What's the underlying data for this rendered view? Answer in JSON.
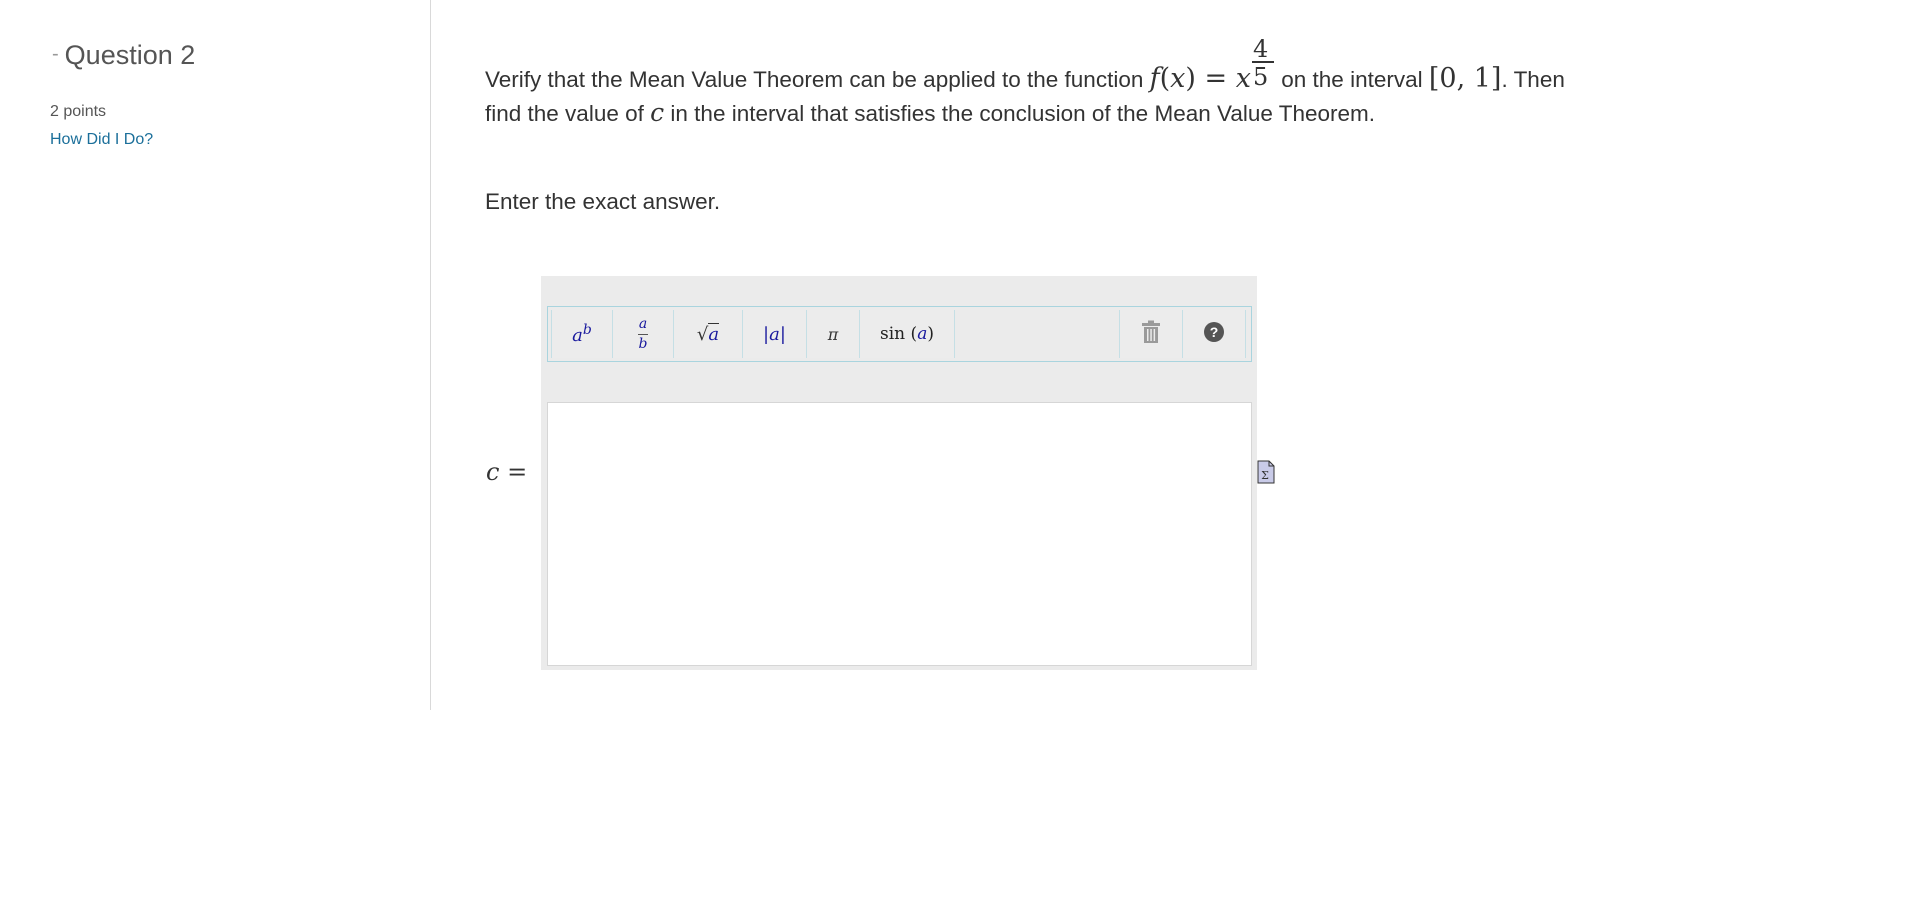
{
  "sidebar": {
    "question_title": "Question 2",
    "collapse_symbol": "-",
    "points": "2 points",
    "feedback_link": "How Did I Do?"
  },
  "question": {
    "text_part1": "Verify that the Mean Value Theorem can be applied to the function",
    "func_f": "f",
    "func_x_open": "(",
    "func_x": "x",
    "func_x_close": ")",
    "equals": "=",
    "base_x": "x",
    "exponent_numerator": "4",
    "exponent_denominator": "5",
    "text_part2": "on the interval",
    "interval": "[0, 1]",
    "text_part3": ". Then",
    "text_line2_a": "find the value of",
    "var_c": "c",
    "text_line2_b": "in the interval that satisfies the conclusion of the Mean Value Theorem.",
    "instruction": "Enter the exact answer."
  },
  "answer": {
    "label_var": "c",
    "label_eq": "=",
    "value": ""
  },
  "toolbar": {
    "power_base": "a",
    "power_exp": "b",
    "frac_num": "a",
    "frac_den": "b",
    "sqrt_arg": "a",
    "abs_arg": "a",
    "pi": "π",
    "sin_fn": "sin",
    "sin_arg": "a",
    "trash_icon": "trash-icon",
    "help_icon": "help-icon",
    "help_symbol": "?"
  },
  "colors": {
    "link": "#1b6f9a",
    "toolbar_text": "#1a1a9e",
    "toolbar_border": "#a9d4de",
    "widget_bg": "#ebebeb"
  }
}
